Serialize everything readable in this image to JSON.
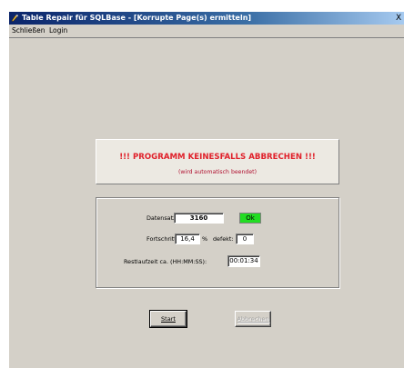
{
  "window": {
    "title": "Table Repair für SQLBase - [Korrupte Page(s) ermitteln]",
    "close_glyph": "X"
  },
  "menu": {
    "items": [
      "Schließen",
      "Login"
    ]
  },
  "warning": {
    "title": "!!! PROGRAMM KEINESFALLS ABBRECHEN !!!",
    "subtitle": "(wird automatisch beendet)"
  },
  "status": {
    "record_label": "Datensatz:",
    "record_value": "3160",
    "ok_label": "Ok",
    "progress_label": "Fortschritt:",
    "progress_value": "16,4",
    "progress_unit": "%",
    "defect_label": "defekt:",
    "defect_value": "0",
    "remaining_label": "Restlaufzeit ca. (HH:MM:SS):",
    "remaining_value": "00:01:34"
  },
  "buttons": {
    "start": "Start",
    "abort": "Abbrechen"
  },
  "colors": {
    "warning_text": "#e0202a",
    "ok_green": "#22dd22",
    "titlebar": "#0a246a"
  }
}
